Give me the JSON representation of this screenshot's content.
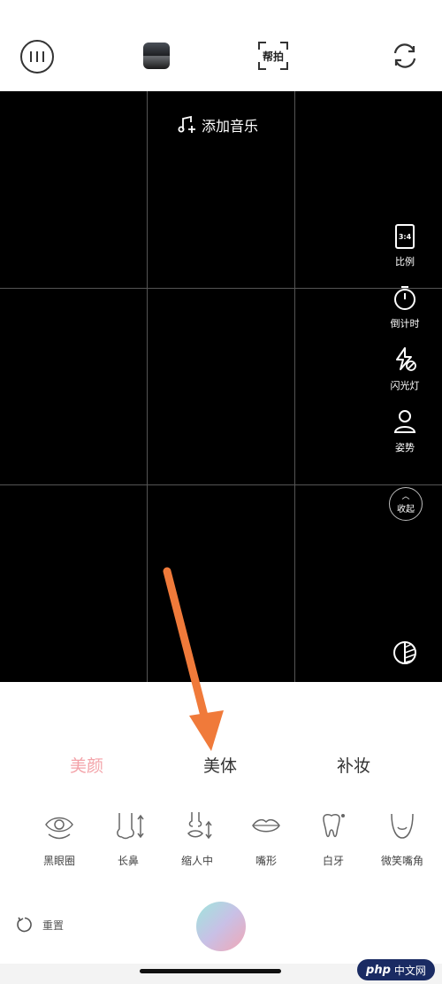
{
  "topbar": {
    "help_label": "帮拍"
  },
  "viewfinder": {
    "music_label": "添加音乐",
    "side_tools": [
      {
        "icon": "ratio-icon",
        "label": "比例",
        "badge": "3:4"
      },
      {
        "icon": "timer-icon",
        "label": "倒计时"
      },
      {
        "icon": "flash-off-icon",
        "label": "闪光灯"
      },
      {
        "icon": "pose-icon",
        "label": "姿势"
      }
    ],
    "collapse_label": "收起"
  },
  "panel": {
    "tabs": [
      {
        "label": "美颜",
        "active": true
      },
      {
        "label": "美体",
        "active": false
      },
      {
        "label": "补妆",
        "active": false
      }
    ],
    "items": [
      {
        "icon": "eye-icon",
        "label": "黑眼圈"
      },
      {
        "icon": "nose-length-icon",
        "label": "长鼻"
      },
      {
        "icon": "philtrum-icon",
        "label": "缩人中"
      },
      {
        "icon": "lips-icon",
        "label": "嘴形"
      },
      {
        "icon": "tooth-icon",
        "label": "白牙"
      },
      {
        "icon": "smile-icon",
        "label": "微笑嘴角"
      }
    ],
    "reset_label": "重置"
  },
  "watermark": {
    "brand": "php",
    "site": "中文网"
  },
  "colors": {
    "accent_pink": "#f3a2a8",
    "arrow_orange": "#f07a3a"
  }
}
